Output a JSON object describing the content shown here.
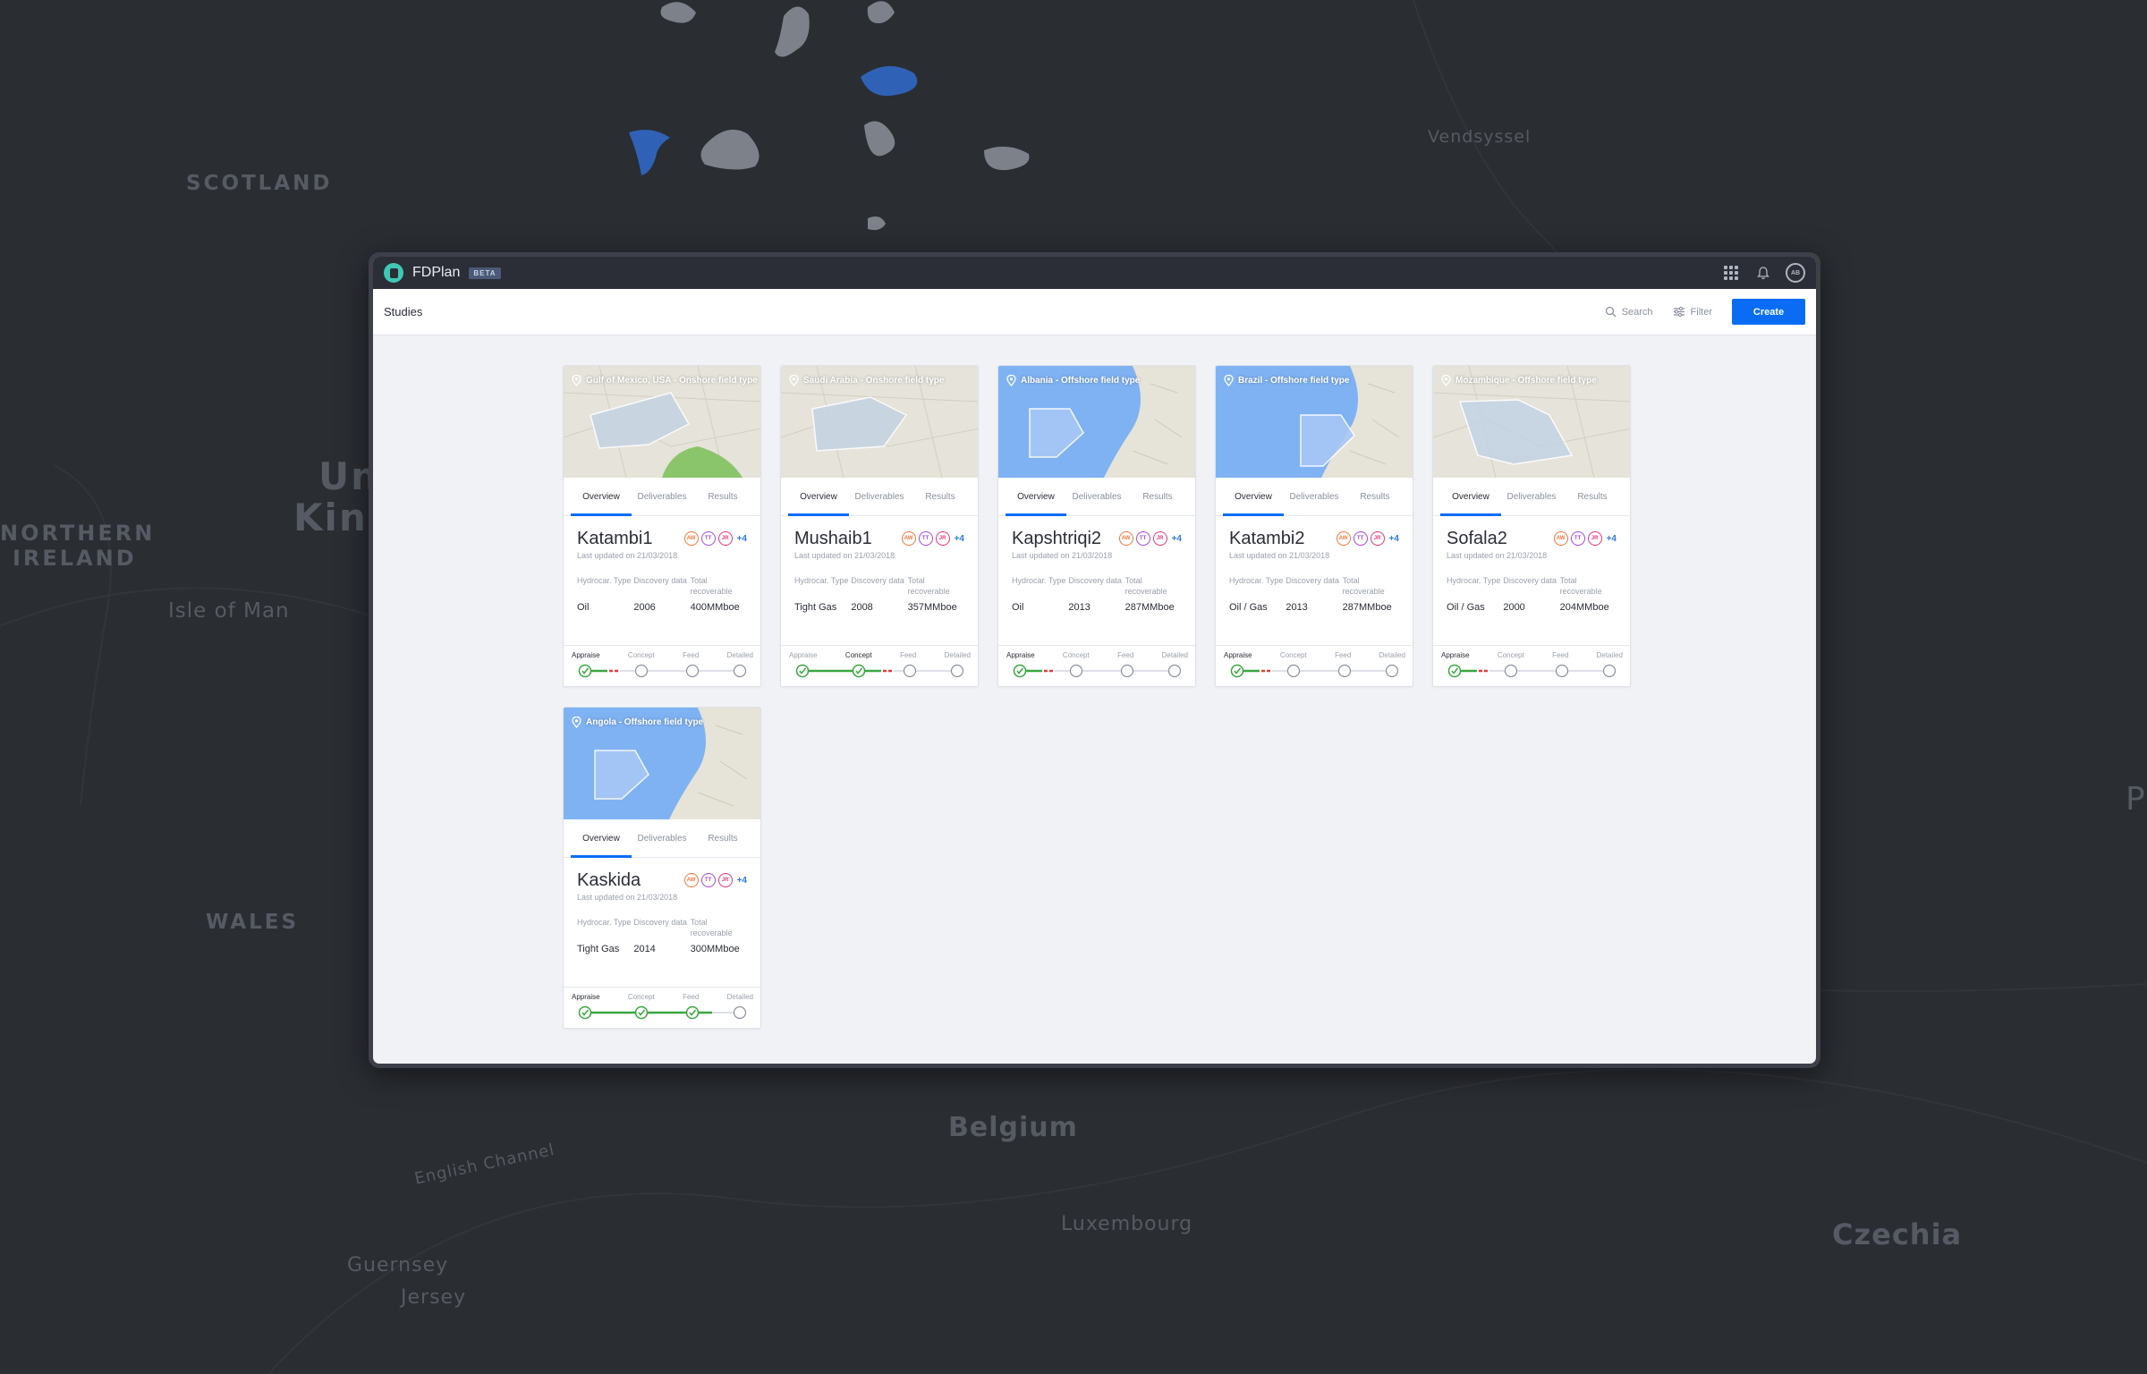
{
  "map_labels": [
    "SCOTLAND",
    "Un",
    "Kin",
    "NORTHERN",
    "IRELAND",
    "Isle of Man",
    "WALES",
    "Belgium",
    "English Channel",
    "Guernsey",
    "Jersey",
    "Luxembourg",
    "Czechia",
    "Vendsyssel",
    "P"
  ],
  "app": {
    "name": "FDPlan",
    "badge": "BETA",
    "avatar": "AB"
  },
  "header": {
    "title": "Studies",
    "search_label": "Search",
    "filter_label": "Filter",
    "create_label": "Create"
  },
  "tabs": [
    "Overview",
    "Deliverables",
    "Results"
  ],
  "stat_labels": {
    "type": "Hydrocar. Type",
    "discovery": "Discovery data",
    "recoverable": "Total recoverable"
  },
  "stages": [
    "Appraise",
    "Concept",
    "Feed",
    "Detailed"
  ],
  "cards": [
    {
      "location": "Gulf of Mexico, USA - Onshore field type",
      "title": "Katambi1",
      "members": [
        "AW",
        "TT",
        "JR"
      ],
      "more": "+4",
      "updated": "Last updated on 21/03/2018",
      "type": "Oil",
      "discovery": "2006",
      "recoverable": "400MMboe",
      "current_stage": 0,
      "stage_done": [
        true,
        false,
        false,
        false
      ],
      "map_style": "land"
    },
    {
      "location": "Saudi Arabia - Onshore field type",
      "title": "Mushaib1",
      "members": [
        "AW",
        "TT",
        "JR"
      ],
      "more": "+4",
      "updated": "Last updated on 21/03/2018",
      "type": "Tight Gas",
      "discovery": "2008",
      "recoverable": "357MMboe",
      "current_stage": 1,
      "stage_done": [
        true,
        true,
        false,
        false
      ],
      "map_style": "land"
    },
    {
      "location": "Albania - Offshore field type",
      "title": "Kapshtriqi2",
      "members": [
        "AW",
        "TT",
        "JR"
      ],
      "more": "+4",
      "updated": "Last updated on 21/03/2018",
      "type": "Oil",
      "discovery": "2013",
      "recoverable": "287MMboe",
      "current_stage": 0,
      "stage_done": [
        true,
        false,
        false,
        false
      ],
      "map_style": "sea"
    },
    {
      "location": "Brazil - Offshore field type",
      "title": "Katambi2",
      "members": [
        "AW",
        "TT",
        "JR"
      ],
      "more": "+4",
      "updated": "Last updated on 21/03/2018",
      "type": "Oil / Gas",
      "discovery": "2013",
      "recoverable": "287MMboe",
      "current_stage": 0,
      "stage_done": [
        true,
        false,
        false,
        false
      ],
      "map_style": "sea"
    },
    {
      "location": "Mozambique - Offshore field type",
      "title": "Sofala2",
      "members": [
        "AW",
        "TT",
        "JR"
      ],
      "more": "+4",
      "updated": "Last updated on 21/03/2018",
      "type": "Oil / Gas",
      "discovery": "2000",
      "recoverable": "204MMboe",
      "current_stage": 0,
      "stage_done": [
        true,
        false,
        false,
        false
      ],
      "map_style": "land"
    },
    {
      "location": "Angola - Offshore field type",
      "title": "Kaskida",
      "members": [
        "AW",
        "TT",
        "JR"
      ],
      "more": "+4",
      "updated": "Last updated on 21/03/2018",
      "type": "Tight Gas",
      "discovery": "2014",
      "recoverable": "300MMboe",
      "current_stage": 0,
      "stage_done": [
        true,
        true,
        true,
        false
      ],
      "map_style": "sea"
    }
  ]
}
